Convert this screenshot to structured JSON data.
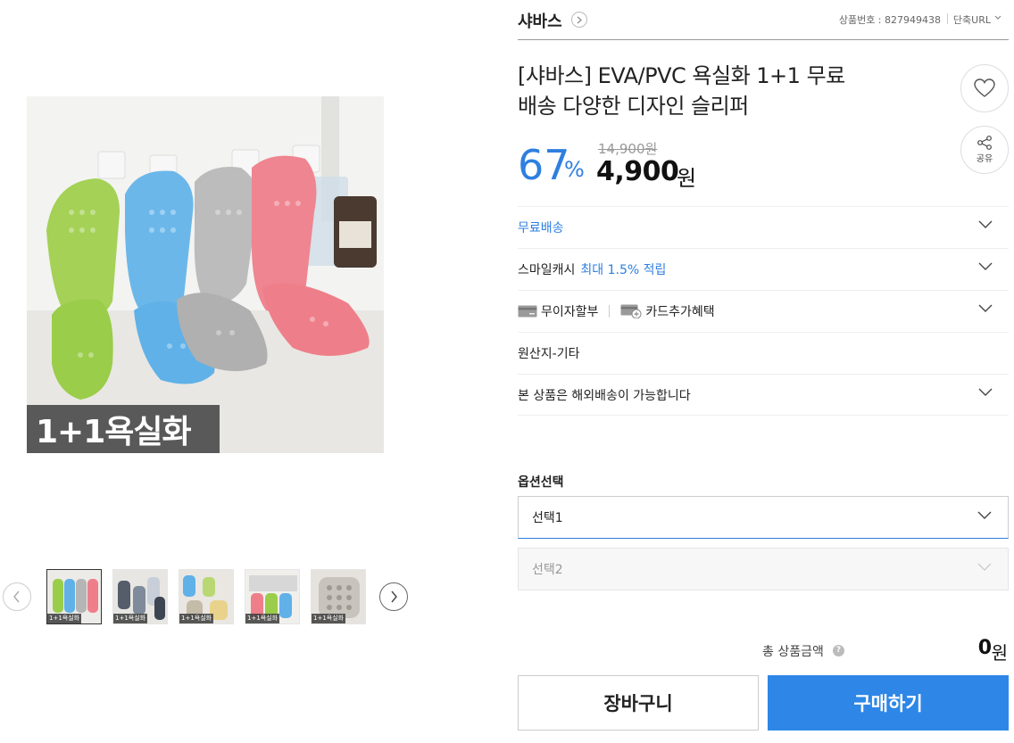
{
  "brand": {
    "name": "샤바스",
    "product_no": "상품번호 : 827949438",
    "short_url": "단축URL"
  },
  "product": {
    "title_line1": "[샤바스] EVA/PVC 욕실화 1+1 무료",
    "title_line2": "배송 다양한 디자인 슬리퍼",
    "discount": "67",
    "discount_unit": "%",
    "original_price": "14,900원",
    "sale_price": "4,900",
    "sale_unit": "원"
  },
  "actions": {
    "share_label": "공유"
  },
  "image": {
    "badge": "1+1욕실화"
  },
  "thumbnails": [
    {
      "label": "1+1욕실화",
      "colors": [
        "#9acd4a",
        "#5fb1e8",
        "#b5b5b5",
        "#ee7f8a"
      ]
    },
    {
      "label": "1+1욕실화",
      "colors": [
        "#555c6a",
        "#7f8a9a",
        "#c9cfd8",
        "#3e4552"
      ]
    },
    {
      "label": "1+1욕실화",
      "colors": [
        "#5fb1e8",
        "#b9d873",
        "#c4bba8",
        "#e9d38c"
      ]
    },
    {
      "label": "1+1욕실화",
      "colors": [
        "#ee7f8a",
        "#9acd4a",
        "#5fb1e8",
        "#d7d7d7"
      ]
    },
    {
      "label": "1+1욕실화",
      "colors": [
        "#c9c3bd",
        "#a09a94",
        "#e6ded6",
        "#cfc7bf"
      ]
    }
  ],
  "info": {
    "shipping": "무료배송",
    "smile_cash_prefix": "스마일캐시",
    "smile_cash_value": "최대 1.5% 적립",
    "installment": "무이자할부",
    "card_benefit": "카드추가혜택",
    "origin": "원산지-기타",
    "overseas": "본 상품은 해외배송이 가능합니다"
  },
  "options": {
    "label": "옵션선택",
    "select1": "선택1",
    "select2": "선택2"
  },
  "total": {
    "label": "총 상품금액",
    "help": "?",
    "value": "0",
    "unit": "원"
  },
  "buttons": {
    "cart": "장바구니",
    "buy": "구매하기"
  },
  "colors": {
    "accent": "#2e7fe0",
    "buy_button": "#2e87e6"
  }
}
